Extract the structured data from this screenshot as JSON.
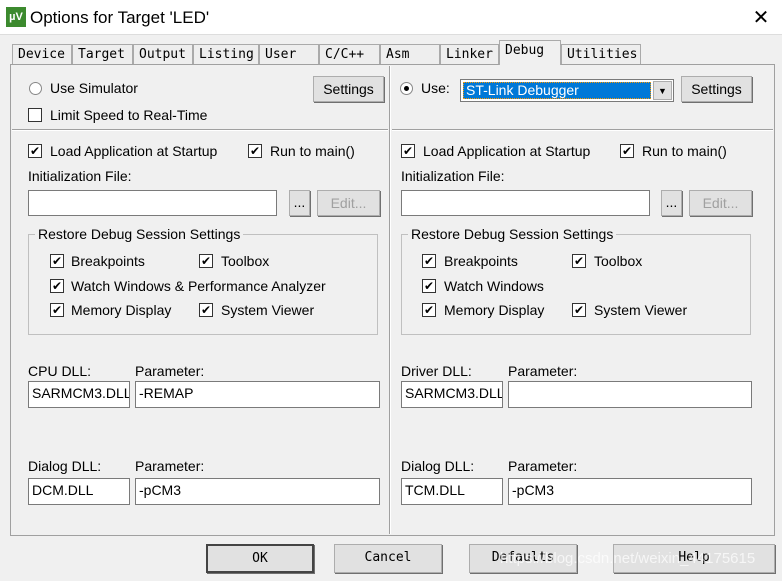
{
  "window": {
    "title": "Options for Target 'LED'",
    "logo": "µV",
    "close": "✕"
  },
  "tabs": [
    "Device",
    "Target",
    "Output",
    "Listing",
    "User",
    "C/C++",
    "Asm",
    "Linker",
    "Debug",
    "Utilities"
  ],
  "active_tab": "Debug",
  "left": {
    "use_simulator": "Use Simulator",
    "settings": "Settings",
    "limit_speed": "Limit Speed to Real-Time",
    "load_app": "Load Application at Startup",
    "run_main": "Run to main()",
    "init_file": "Initialization File:",
    "init_value": "",
    "browse": "...",
    "edit": "Edit...",
    "restore_group": "Restore Debug Session Settings",
    "breakpoints": "Breakpoints",
    "toolbox": "Toolbox",
    "watch": "Watch Windows & Performance Analyzer",
    "memory": "Memory Display",
    "sysviewer": "System Viewer",
    "cpu_dll": "CPU DLL:",
    "cpu_dll_value": "SARMCM3.DLL",
    "param": "Parameter:",
    "cpu_param": "-REMAP",
    "dialog_dll": "Dialog DLL:",
    "dialog_dll_value": "DCM.DLL",
    "dialog_param": "-pCM3"
  },
  "right": {
    "use": "Use:",
    "debugger": "ST-Link Debugger",
    "settings": "Settings",
    "load_app": "Load Application at Startup",
    "run_main": "Run to main()",
    "init_file": "Initialization File:",
    "init_value": "",
    "browse": "...",
    "edit": "Edit...",
    "restore_group": "Restore Debug Session Settings",
    "breakpoints": "Breakpoints",
    "toolbox": "Toolbox",
    "watch": "Watch Windows",
    "memory": "Memory Display",
    "sysviewer": "System Viewer",
    "driver_dll": "Driver DLL:",
    "driver_dll_value": "SARMCM3.DLL",
    "param": "Parameter:",
    "driver_param": "",
    "dialog_dll": "Dialog DLL:",
    "dialog_dll_value": "TCM.DLL",
    "dialog_param": "-pCM3"
  },
  "buttons": {
    "ok": "OK",
    "cancel": "Cancel",
    "defaults": "Defaults",
    "help": "Help"
  },
  "watermark": "https://blog.csdn.net/weixin_44175615",
  "check": "✔"
}
